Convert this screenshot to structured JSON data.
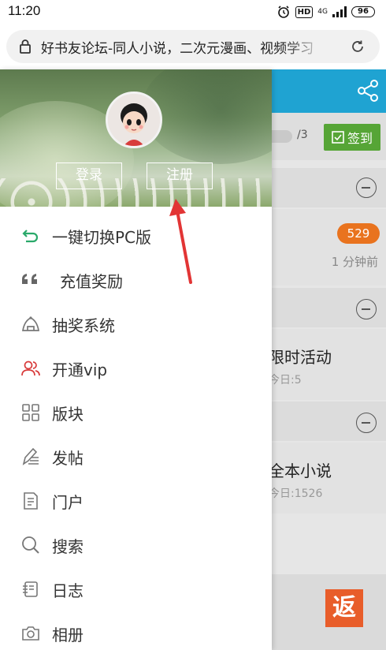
{
  "status_bar": {
    "time": "11:20",
    "hd": "HD",
    "network": "4G",
    "battery": "96"
  },
  "url_bar": {
    "text": "好书友论坛-同人小说，二次元漫画、视频学习"
  },
  "drawer": {
    "login_label": "登录",
    "register_label": "注册",
    "menu_items": [
      {
        "label": "一键切换PC版",
        "icon": "switch-arrow-icon",
        "color": "#2aa96a"
      },
      {
        "label": "充值奖励",
        "icon": "quote-icon",
        "color": "#555555"
      },
      {
        "label": "抽奖系统",
        "icon": "lottery-icon",
        "color": "#555555"
      },
      {
        "label": "开通vip",
        "icon": "vip-users-icon",
        "color": "#d83a3a"
      },
      {
        "label": "版块",
        "icon": "grid-icon",
        "color": "#555555"
      },
      {
        "label": "发帖",
        "icon": "pen-icon",
        "color": "#555555"
      },
      {
        "label": "门户",
        "icon": "document-icon",
        "color": "#555555"
      },
      {
        "label": "搜索",
        "icon": "search-icon",
        "color": "#555555"
      },
      {
        "label": "日志",
        "icon": "log-icon",
        "color": "#555555"
      },
      {
        "label": "相册",
        "icon": "camera-icon",
        "color": "#555555"
      }
    ]
  },
  "background_page": {
    "header_color": "#1fa3d2",
    "page_indicator": "/3",
    "sign_label": "签到",
    "badge_count": "529",
    "time_ago": "1 分钟前",
    "forum1_title": "限时活动",
    "forum1_today": "今日:5",
    "forum2_title": "全本小说",
    "forum2_today": "今日:1526",
    "float_button": "返"
  }
}
